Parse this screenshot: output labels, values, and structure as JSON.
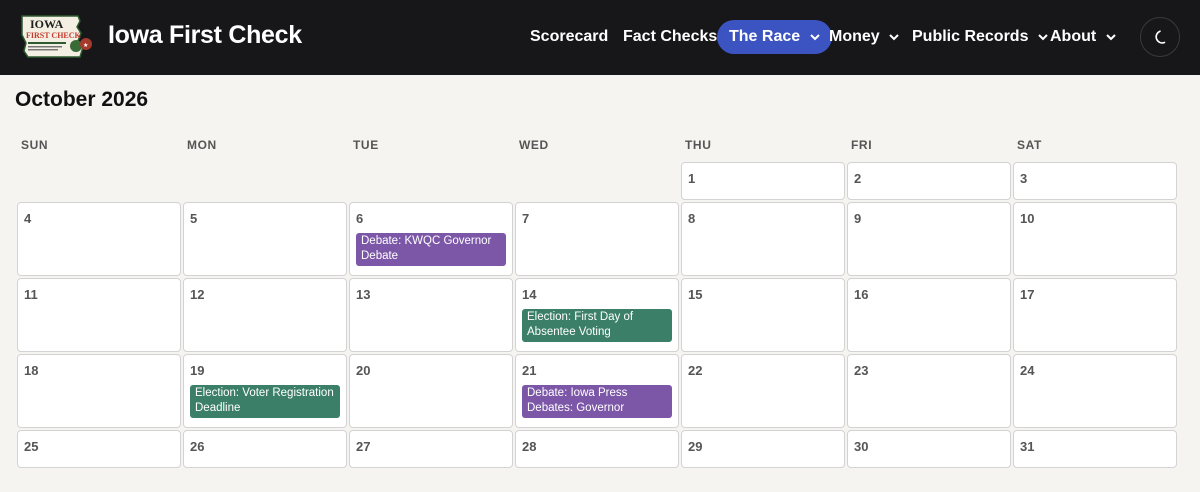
{
  "header": {
    "site_title": "Iowa First Check",
    "logo": {
      "line1": "IOWA",
      "line2": "FIRST CHECK"
    },
    "nav": [
      {
        "label": "Scorecard",
        "dropdown": false,
        "active": false
      },
      {
        "label": "Fact Checks",
        "dropdown": false,
        "active": false
      },
      {
        "label": "The Race",
        "dropdown": true,
        "active": true
      },
      {
        "label": "Money",
        "dropdown": true,
        "active": false
      },
      {
        "label": "Public Records",
        "dropdown": true,
        "active": false
      },
      {
        "label": "About",
        "dropdown": true,
        "active": false
      }
    ],
    "theme_toggle_icon": "moon-icon",
    "active_color": "#3b54c2"
  },
  "calendar": {
    "month_title": "October 2026",
    "weekdays": [
      "SUN",
      "MON",
      "TUE",
      "WED",
      "THU",
      "FRI",
      "SAT"
    ],
    "weeks": [
      [
        null,
        null,
        null,
        null,
        {
          "day": "1"
        },
        {
          "day": "2"
        },
        {
          "day": "3"
        }
      ],
      [
        {
          "day": "4"
        },
        {
          "day": "5"
        },
        {
          "day": "6",
          "event": {
            "label": "Debate: KWQC Governor Debate",
            "kind": "debate"
          }
        },
        {
          "day": "7"
        },
        {
          "day": "8"
        },
        {
          "day": "9"
        },
        {
          "day": "10"
        }
      ],
      [
        {
          "day": "11"
        },
        {
          "day": "12"
        },
        {
          "day": "13"
        },
        {
          "day": "14",
          "event": {
            "label": "Election: First Day of Absentee Voting",
            "kind": "election"
          }
        },
        {
          "day": "15"
        },
        {
          "day": "16"
        },
        {
          "day": "17"
        }
      ],
      [
        {
          "day": "18"
        },
        {
          "day": "19",
          "event": {
            "label": "Election: Voter Registration Deadline",
            "kind": "election"
          }
        },
        {
          "day": "20"
        },
        {
          "day": "21",
          "event": {
            "label": "Debate: Iowa Press Debates: Governor",
            "kind": "debate"
          }
        },
        {
          "day": "22"
        },
        {
          "day": "23"
        },
        {
          "day": "24"
        }
      ],
      [
        {
          "day": "25"
        },
        {
          "day": "26"
        },
        {
          "day": "27"
        },
        {
          "day": "28"
        },
        {
          "day": "29"
        },
        {
          "day": "30"
        },
        {
          "day": "31"
        }
      ]
    ],
    "event_colors": {
      "debate": "#7c57a8",
      "election": "#3b7f68"
    }
  }
}
